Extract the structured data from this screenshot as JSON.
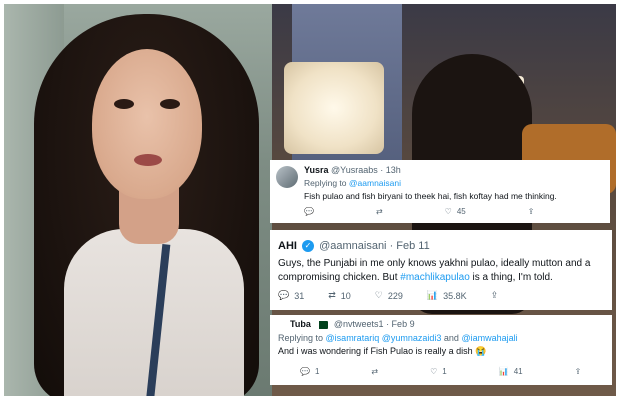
{
  "tweets": [
    {
      "display_name": "Yusra",
      "handle": "@Yusraabs",
      "time": "· 13h",
      "replying_prefix": "Replying to",
      "replying_to": "@aamnaisani",
      "text": "Fish pulao and fish biryani to theek hai, fish koftay had me thinking.",
      "likes": "45"
    },
    {
      "display_name": "AHI",
      "handle": "@aamnaisani",
      "time": "· Feb 11",
      "text_before": "Guys, the Punjabi in me only knows yakhni pulao, ideally mutton and a compromising chicken. But ",
      "hashtag": "#machlikapulao",
      "text_after": " is a thing, I'm told.",
      "replies": "31",
      "retweets": "10",
      "likes": "229",
      "views": "35.8K"
    },
    {
      "display_name": "Tuba",
      "handle": "@nvtweets1",
      "time": "· Feb 9",
      "replying_prefix": "Replying to",
      "replying_to_1": "@isamratariq",
      "replying_to_2": "@yumnazaidi3",
      "replying_and": "and",
      "replying_to_3": "@iamwahajali",
      "text": "And i was wondering if Fish Pulao is really a dish 😭",
      "replies": "1",
      "likes": "1",
      "views": "41"
    }
  ],
  "icons": {
    "reply": "💬",
    "retweet": "⇄",
    "like": "♡",
    "views": "📊",
    "share": "⇪",
    "verified": "✓"
  },
  "colors": {
    "link": "#1d9bf0",
    "muted": "#536471",
    "text": "#0f1419"
  }
}
